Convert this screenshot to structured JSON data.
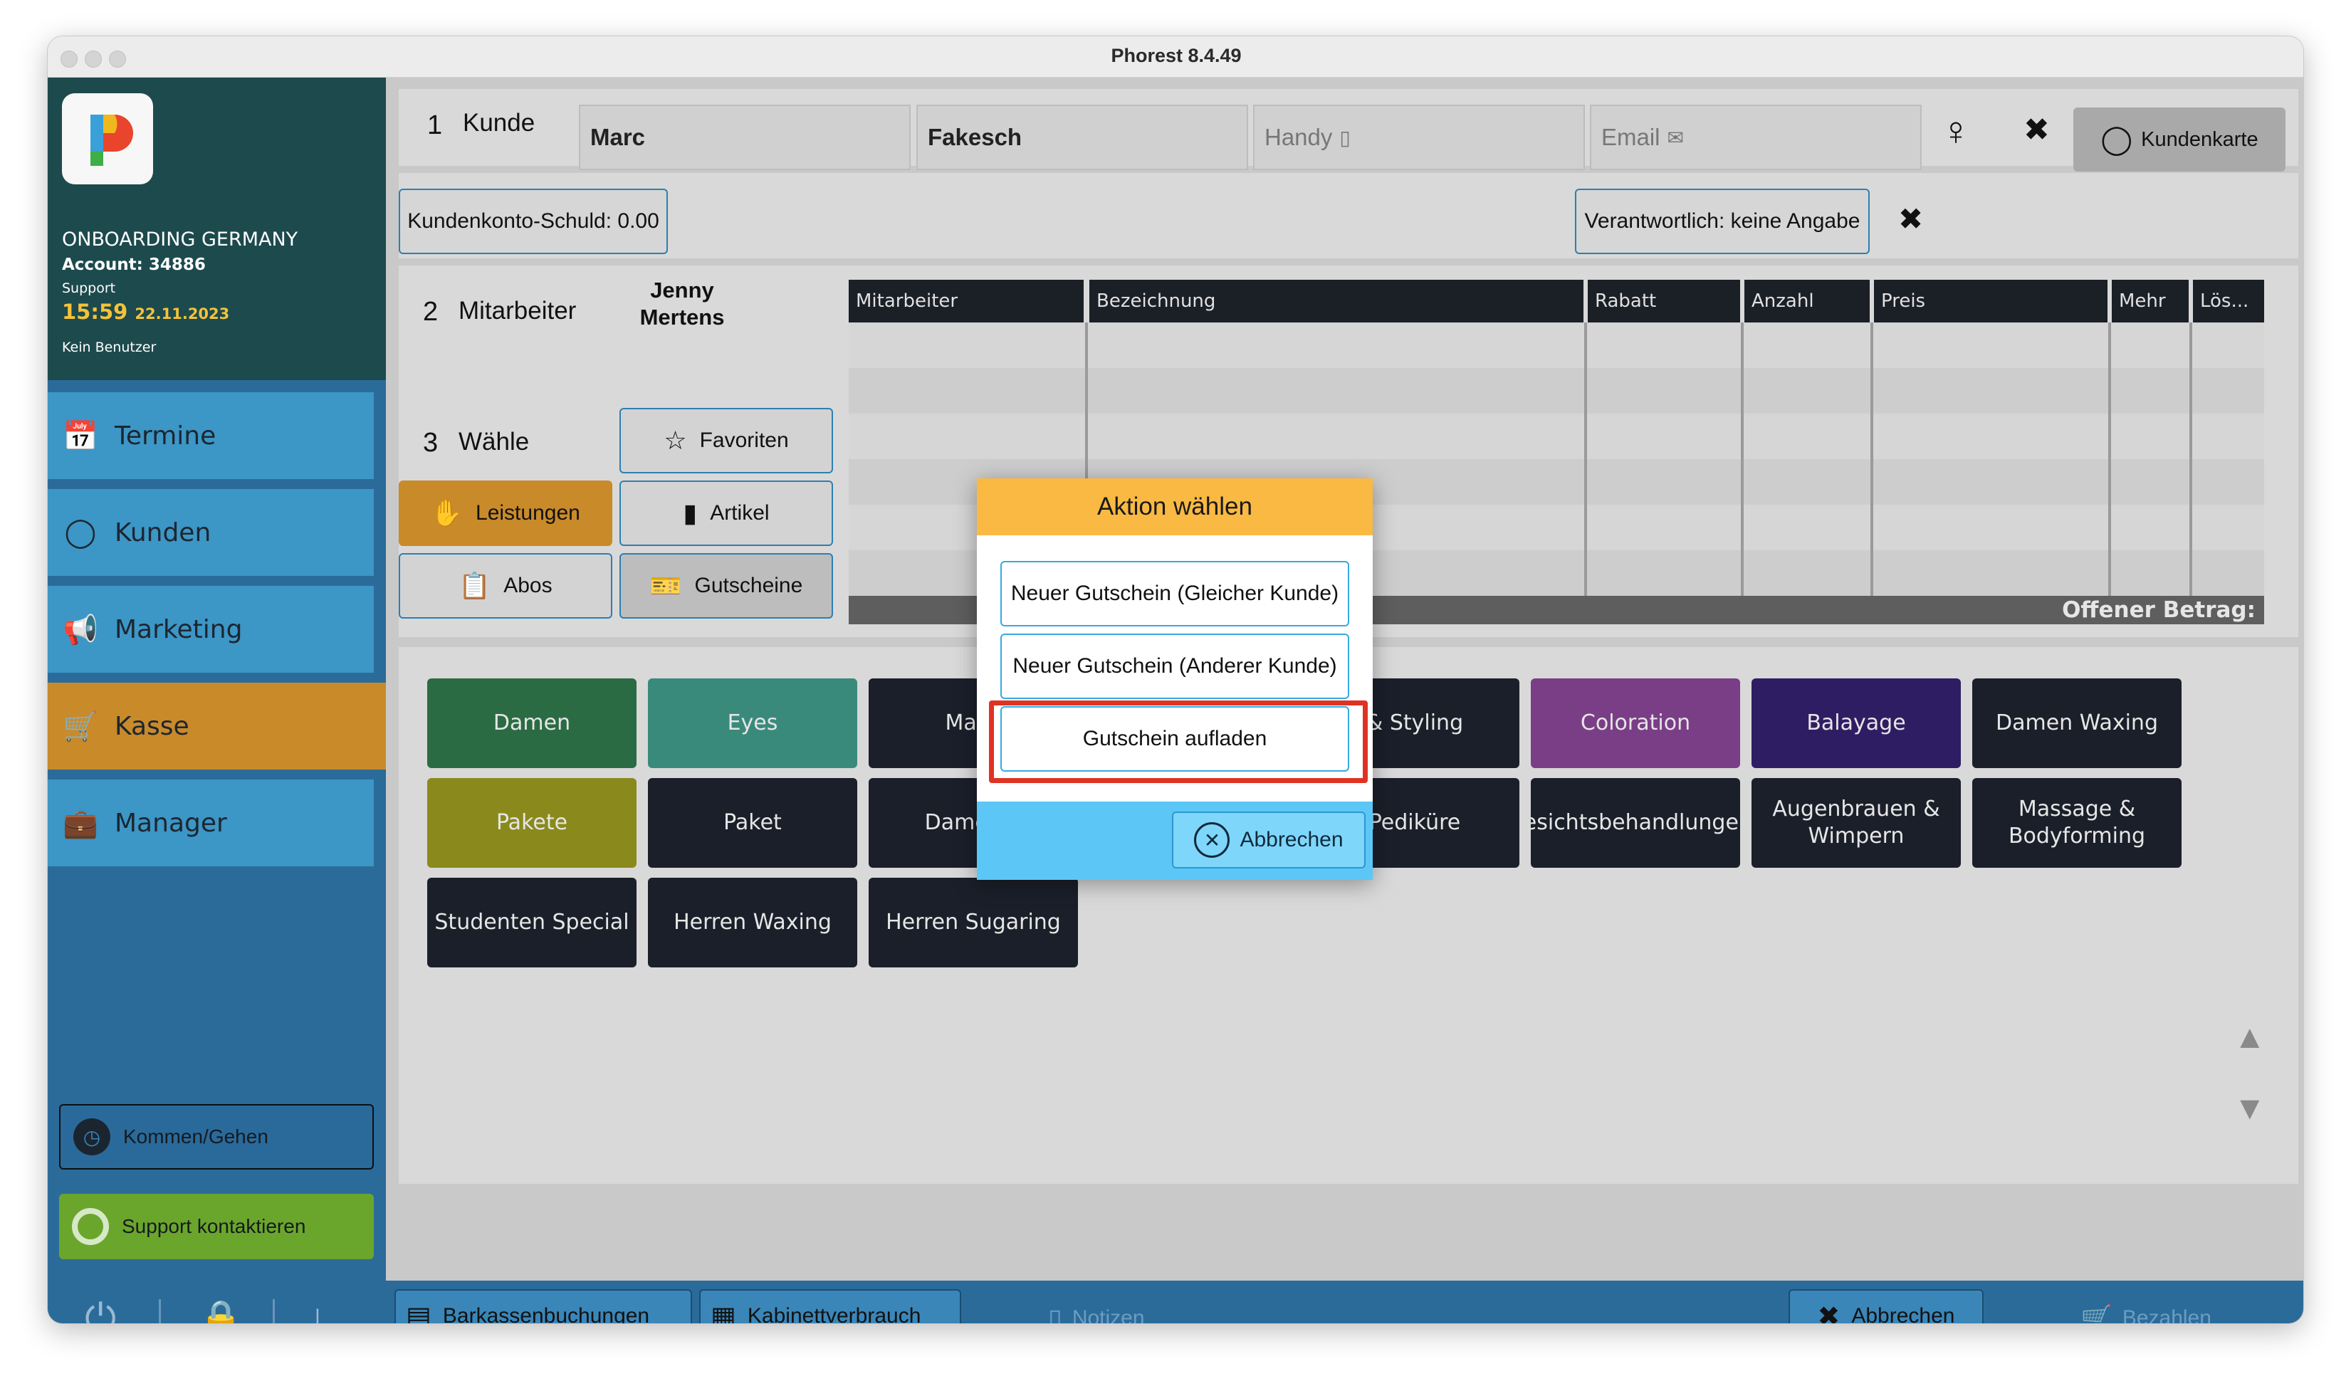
{
  "window": {
    "title": "Phorest 8.4.49"
  },
  "sidebar": {
    "org": "ONBOARDING GERMANY",
    "account": "Account: 34886",
    "role": "Support",
    "time": "15:59",
    "date": "22.11.2023",
    "user": "Kein Benutzer",
    "nav": [
      {
        "label": "Termine",
        "icon": "calendar-edit-icon"
      },
      {
        "label": "Kunden",
        "icon": "head-profile-icon"
      },
      {
        "label": "Marketing",
        "icon": "megaphone-icon"
      },
      {
        "label": "Kasse",
        "icon": "cart-icon",
        "active": true
      },
      {
        "label": "Manager",
        "icon": "briefcase-icon"
      }
    ],
    "clock_label": "Kommen/Gehen",
    "support_label": "Support kontaktieren",
    "active_color": "#c98a2a",
    "support_color": "#6aa62b"
  },
  "customer": {
    "step_num": "1",
    "step_label": "Kunde",
    "first_name": "Marc",
    "last_name": "Fakesch",
    "phone_placeholder": "Handy",
    "email_placeholder": "Email",
    "card_button": "Kundenkarte",
    "debt": "Kundenkonto-Schuld: 0.00",
    "responsible": "Verantwortlich: keine Angabe"
  },
  "staff": {
    "step_num": "2",
    "step_label": "Mitarbeiter",
    "name": "Jenny\nMertens"
  },
  "choose": {
    "step_num": "3",
    "step_label": "Wähle",
    "buttons": [
      {
        "label": "Favoriten",
        "icon": "star-box-icon"
      },
      {
        "label": "Leistungen",
        "icon": "handshake-icon",
        "active": true
      },
      {
        "label": "Artikel",
        "icon": "bottle-icon"
      },
      {
        "label": "Abos",
        "icon": "clipboard-icon"
      },
      {
        "label": "Gutscheine",
        "icon": "voucher-icon"
      }
    ]
  },
  "table": {
    "headers": [
      "Mitarbeiter",
      "Bezeichnung",
      "Rabatt",
      "Anzahl",
      "Preis",
      "Mehr",
      "Lös..."
    ],
    "open_amount_label": "Offener Betrag:"
  },
  "categories": [
    {
      "label": "Damen",
      "color": "#2b6b44"
    },
    {
      "label": "Eyes",
      "color": "#3a8a7c"
    },
    {
      "label": "Make",
      "color": "#1b1f2a"
    },
    {
      "label": "",
      "color": "#1b1f2a"
    },
    {
      "label": "& Styling",
      "color": "#1b1f2a"
    },
    {
      "label": "Coloration",
      "color": "#7a3e86"
    },
    {
      "label": "Balayage",
      "color": "#2f1d63"
    },
    {
      "label": "Damen Waxing",
      "color": "#1b1f2a"
    },
    {
      "label": "Pakete",
      "color": "#8a8a1c"
    },
    {
      "label": "Paket",
      "color": "#1b1f2a"
    },
    {
      "label": "Damen S",
      "color": "#1b1f2a"
    },
    {
      "label": "",
      "color": "#1b1f2a"
    },
    {
      "label": "Pediküre",
      "color": "#1b1f2a"
    },
    {
      "label": "esichtsbehandlunger",
      "color": "#1b1f2a"
    },
    {
      "label": "Augenbrauen &\nWimpern",
      "color": "#1b1f2a"
    },
    {
      "label": "Massage &\nBodyforming",
      "color": "#1b1f2a"
    },
    {
      "label": "Studenten Special",
      "color": "#1b1f2a"
    },
    {
      "label": "Herren Waxing",
      "color": "#1b1f2a"
    },
    {
      "label": "Herren Sugaring",
      "color": "#1b1f2a"
    }
  ],
  "bottom": {
    "cash_bookings": "Barkassenbuchungen",
    "cabinet": "Kabinettverbrauch",
    "notes": "Notizen",
    "cancel": "Abbrechen",
    "pay": "Bezahlen"
  },
  "dialog": {
    "title": "Aktion wählen",
    "options": [
      "Neuer Gutschein  (Gleicher Kunde)",
      "Neuer Gutschein (Anderer Kunde)",
      "Gutschein aufladen"
    ],
    "cancel": "Abbrechen",
    "highlight_color": "#e03223"
  }
}
